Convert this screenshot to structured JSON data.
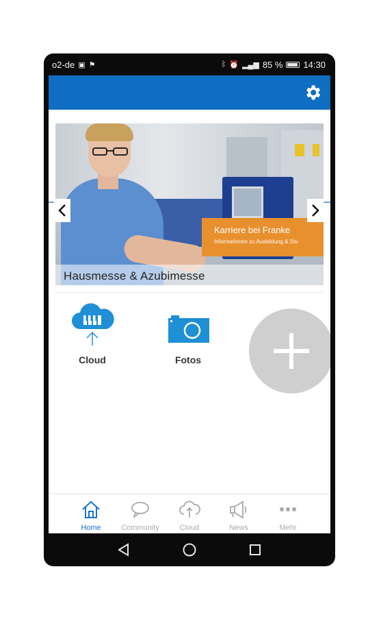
{
  "status_bar": {
    "carrier": "o2-de",
    "left_icons": [
      "sim-icon",
      "flag-icon"
    ],
    "right_icons": [
      "bluetooth-icon",
      "alarm-icon",
      "signal-icon"
    ],
    "battery_text": "85 %",
    "time": "14:30"
  },
  "app_bar": {
    "settings_icon": "gear-icon",
    "color": "#0f6dc2"
  },
  "banner": {
    "caption": "Hausmesse & Azubimesse",
    "card_title": "Karriere bei Franke",
    "card_subtitle": "Informationen zu Ausbildung & Stu",
    "card_color": "#e8902e"
  },
  "tiles": [
    {
      "label": "Cloud",
      "icon": "cloud-icon"
    },
    {
      "label": "Fotos",
      "icon": "camera-icon"
    }
  ],
  "fab": {
    "icon": "plus-icon"
  },
  "bottom_nav": [
    {
      "label": "Home",
      "icon": "home-icon",
      "active": true
    },
    {
      "label": "Community",
      "icon": "chat-icon",
      "active": false
    },
    {
      "label": "Cloud",
      "icon": "cloud-upload-icon",
      "active": false
    },
    {
      "label": "News",
      "icon": "megaphone-icon",
      "active": false
    },
    {
      "label": "Mehr",
      "icon": "more-icon",
      "active": false
    }
  ],
  "colors": {
    "accent": "#0f6dc2",
    "nav_active": "#1a73c9",
    "nav_inactive": "#a9a9a9"
  }
}
